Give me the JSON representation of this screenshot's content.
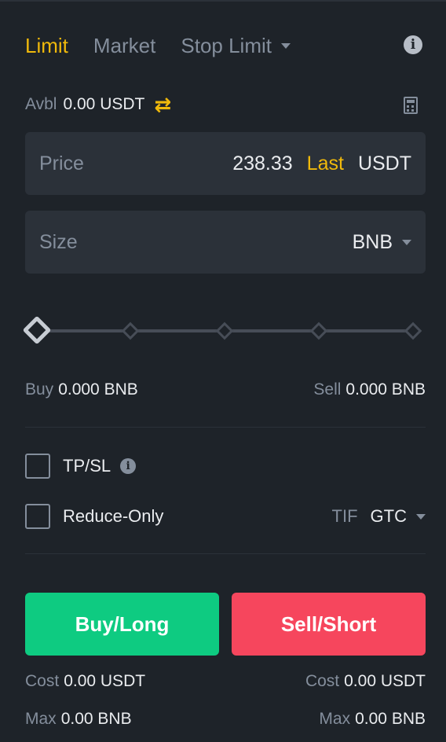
{
  "tabs": {
    "limit": "Limit",
    "market": "Market",
    "stop_limit": "Stop Limit"
  },
  "avbl": {
    "label": "Avbl",
    "value": "0.00 USDT"
  },
  "price": {
    "label": "Price",
    "value": "238.33",
    "last": "Last",
    "unit": "USDT"
  },
  "size": {
    "label": "Size",
    "unit": "BNB"
  },
  "slider": {
    "value_percent": 0,
    "nodes": [
      0,
      25,
      50,
      75,
      100
    ]
  },
  "buy_info": {
    "label": "Buy",
    "value": "0.000 BNB"
  },
  "sell_info": {
    "label": "Sell",
    "value": "0.000 BNB"
  },
  "options": {
    "tpsl": "TP/SL",
    "reduce_only": "Reduce-Only",
    "tif_label": "TIF",
    "tif_value": "GTC"
  },
  "buttons": {
    "buy": "Buy/Long",
    "sell": "Sell/Short"
  },
  "cost": {
    "label": "Cost",
    "buy_value": "0.00 USDT",
    "sell_value": "0.00 USDT"
  },
  "max": {
    "label": "Max",
    "buy_value": "0.00 BNB",
    "sell_value": "0.00 BNB"
  },
  "colors": {
    "background": "#1e2329",
    "input_bg": "#2b3139",
    "accent": "#f0b90b",
    "buy": "#0ecb81",
    "sell": "#f6465d",
    "muted": "#848e9c"
  },
  "icons": {
    "info": "info-icon",
    "swap": "swap-icon",
    "calculator": "calculator-icon"
  }
}
